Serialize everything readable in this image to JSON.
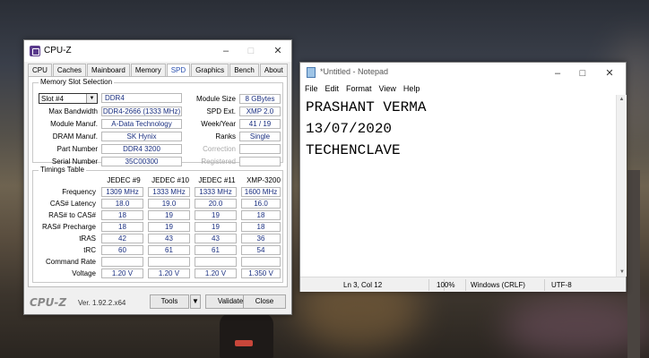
{
  "cpuz": {
    "title": "CPU-Z",
    "tabs": [
      "CPU",
      "Caches",
      "Mainboard",
      "Memory",
      "SPD",
      "Graphics",
      "Bench",
      "About"
    ],
    "active_tab": "SPD",
    "slot_group_title": "Memory Slot Selection",
    "slot_selected": "Slot #4",
    "mem_type": "DDR4",
    "labels": {
      "max_bandwidth": "Max Bandwidth",
      "module_manuf": "Module Manuf.",
      "dram_manuf": "DRAM Manuf.",
      "part_number": "Part Number",
      "serial_number": "Serial Number",
      "module_size": "Module Size",
      "spd_ext": "SPD Ext.",
      "week_year": "Week/Year",
      "ranks": "Ranks",
      "correction": "Correction",
      "registered": "Registered"
    },
    "values": {
      "max_bandwidth": "DDR4-2666 (1333 MHz)",
      "module_manuf": "A-Data Technology",
      "dram_manuf": "SK Hynix",
      "part_number": "DDR4 3200",
      "serial_number": "35C00300",
      "module_size": "8 GBytes",
      "spd_ext": "XMP 2.0",
      "week_year": "41 / 19",
      "ranks": "Single",
      "correction": "",
      "registered": ""
    },
    "timings": {
      "title": "Timings Table",
      "headers": [
        "JEDEC #9",
        "JEDEC #10",
        "JEDEC #11",
        "XMP-3200"
      ],
      "rows": [
        {
          "label": "Frequency",
          "values": [
            "1309 MHz",
            "1333 MHz",
            "1333 MHz",
            "1600 MHz"
          ]
        },
        {
          "label": "CAS# Latency",
          "values": [
            "18.0",
            "19.0",
            "20.0",
            "16.0"
          ]
        },
        {
          "label": "RAS# to CAS#",
          "values": [
            "18",
            "19",
            "19",
            "18"
          ]
        },
        {
          "label": "RAS# Precharge",
          "values": [
            "18",
            "19",
            "19",
            "18"
          ]
        },
        {
          "label": "tRAS",
          "values": [
            "42",
            "43",
            "43",
            "36"
          ]
        },
        {
          "label": "tRC",
          "values": [
            "60",
            "61",
            "61",
            "54"
          ]
        },
        {
          "label": "Command Rate",
          "values": [
            "",
            "",
            "",
            ""
          ]
        },
        {
          "label": "Voltage",
          "values": [
            "1.20 V",
            "1.20 V",
            "1.20 V",
            "1.350 V"
          ]
        }
      ]
    },
    "footer": {
      "brand": "CPU-Z",
      "version": "Ver. 1.92.2.x64",
      "tools_label": "Tools",
      "validate_label": "Validate",
      "close_label": "Close"
    }
  },
  "notepad": {
    "title": "*Untitled - Notepad",
    "menu": [
      "File",
      "Edit",
      "Format",
      "View",
      "Help"
    ],
    "lines": [
      "PRASHANT VERMA",
      "13/07/2020",
      "TECHENCLAVE"
    ],
    "status": {
      "position": "Ln 3, Col 12",
      "zoom": "100%",
      "line_ending": "Windows (CRLF)",
      "encoding": "UTF-8"
    }
  }
}
